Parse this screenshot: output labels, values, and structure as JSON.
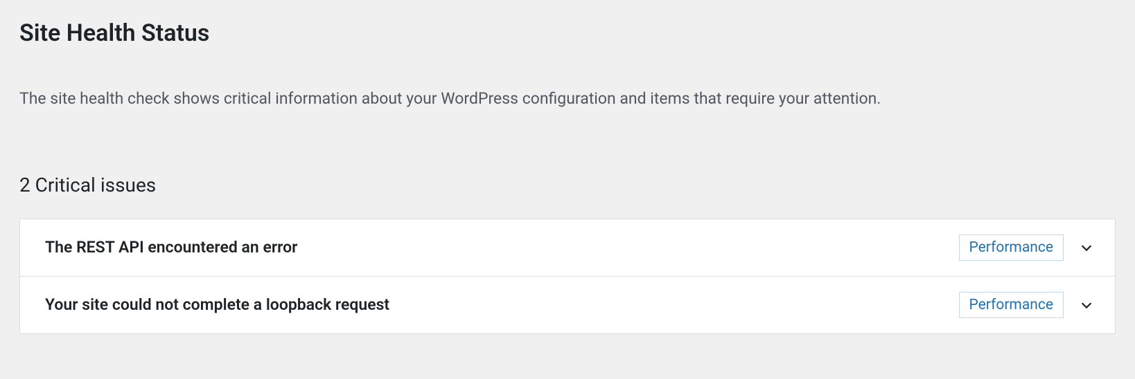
{
  "page": {
    "title": "Site Health Status",
    "description": "The site health check shows critical information about your WordPress configuration and items that require your attention."
  },
  "critical_issues": {
    "heading": "2 Critical issues",
    "items": [
      {
        "title": "The REST API encountered an error",
        "badge": "Performance"
      },
      {
        "title": "Your site could not complete a loopback request",
        "badge": "Performance"
      }
    ]
  }
}
